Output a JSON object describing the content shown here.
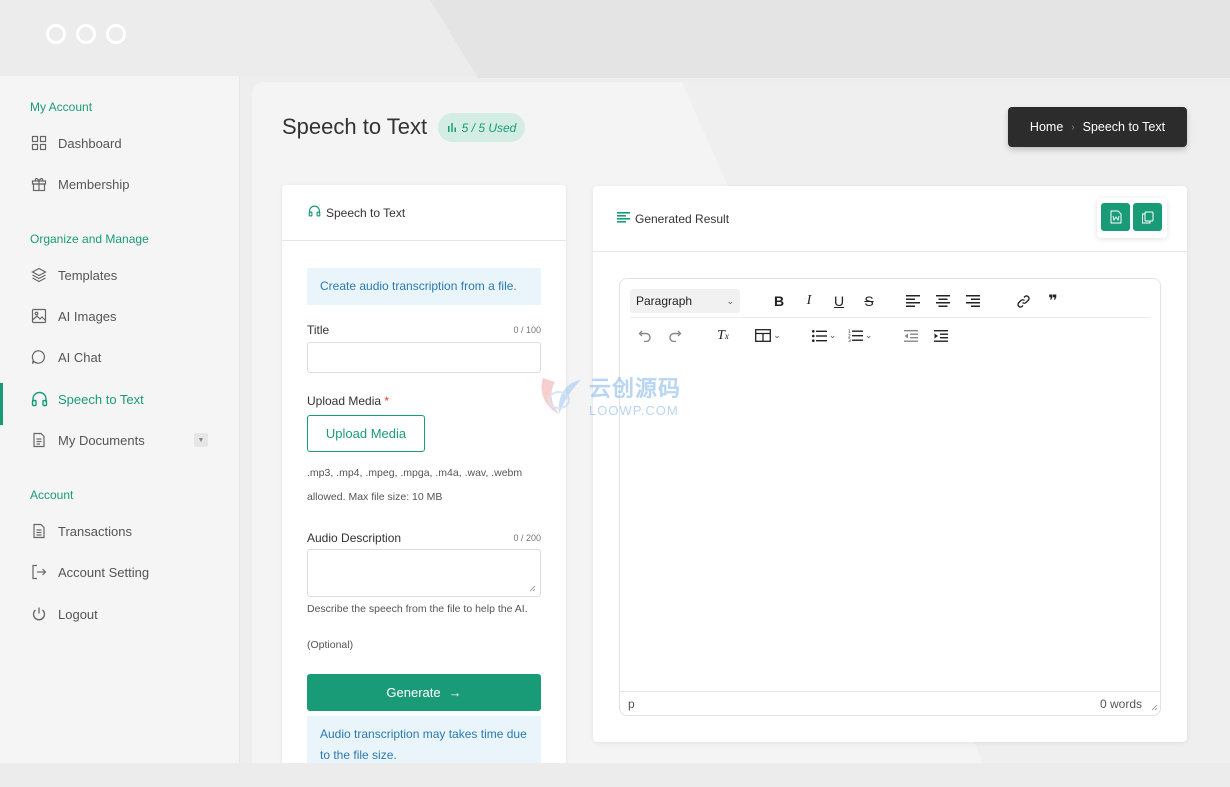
{
  "sidebar": {
    "sections": [
      {
        "label": "My Account"
      },
      {
        "label": "Organize and Manage"
      },
      {
        "label": "Account"
      }
    ],
    "items": [
      {
        "label": "Dashboard",
        "icon": "grid-icon"
      },
      {
        "label": "Membership",
        "icon": "gift-icon"
      },
      {
        "label": "Templates",
        "icon": "layers-icon"
      },
      {
        "label": "AI Images",
        "icon": "image-icon"
      },
      {
        "label": "AI Chat",
        "icon": "chat-icon"
      },
      {
        "label": "Speech to Text",
        "icon": "headphones-icon",
        "active": true
      },
      {
        "label": "My Documents",
        "icon": "document-icon"
      },
      {
        "label": "Transactions",
        "icon": "receipt-icon"
      },
      {
        "label": "Account Setting",
        "icon": "logout-arrow-icon"
      },
      {
        "label": "Logout",
        "icon": "power-icon"
      }
    ]
  },
  "header": {
    "title": "Speech to Text",
    "usage_badge": "5 / 5 Used",
    "breadcrumb": [
      "Home",
      "Speech to Text"
    ]
  },
  "form": {
    "card_title": "Speech to Text",
    "info": "Create audio transcription from a file.",
    "title_label": "Title",
    "title_count": "0 / 100",
    "title_value": "",
    "upload_label": "Upload Media",
    "upload_required": "*",
    "upload_button": "Upload Media",
    "formats_line1": ".mp3, .mp4, .mpeg, .mpga, .m4a, .wav, .webm",
    "formats_line2": "allowed. Max file size: 10 MB",
    "desc_label": "Audio Description",
    "desc_count": "0 / 200",
    "desc_value": "",
    "desc_help": "Describe the speech from the file to help the AI.",
    "desc_optional": "(Optional)",
    "generate_button": "Generate",
    "notice": "Audio transcription may takes time due to the file size."
  },
  "result": {
    "card_title": "Generated Result",
    "block_format": "Paragraph",
    "status_tag": "p",
    "word_count": "0 words"
  },
  "watermark": {
    "line1": "云创源码",
    "line2": "LOOWP.COM"
  },
  "colors": {
    "accent": "#1a9b78",
    "badge_bg": "#d3ece4",
    "info_bg": "#e9f4fb",
    "info_text": "#2a7ab0",
    "breadcrumb_bg": "#2c2c2c"
  }
}
